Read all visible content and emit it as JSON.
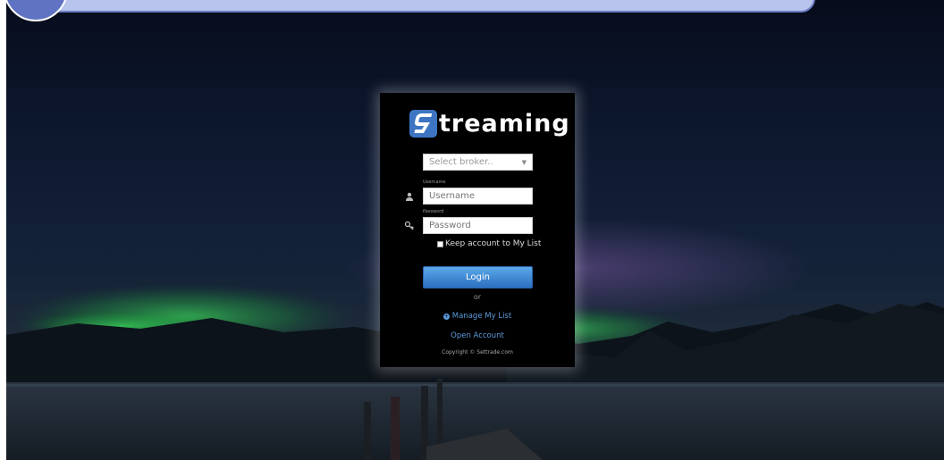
{
  "app": {
    "brand_text": "treaming",
    "brand_mark_letter": "S"
  },
  "form": {
    "broker_placeholder": "Select broker..",
    "username_label": "Username",
    "username_placeholder": "Username",
    "password_label": "Password",
    "password_placeholder": "Password",
    "keep_account_label": "Keep account to My List",
    "keep_account_checked": false,
    "login_label": "Login",
    "or_text": "or",
    "manage_list_label": "Manage My List",
    "open_account_label": "Open Account",
    "copyright": "Copyright © Settrade.com"
  },
  "icons": {
    "username": "user-icon",
    "password": "key-icon",
    "manage": "plus-circle-icon",
    "broker_dropdown": "chevron-down-icon"
  },
  "colors": {
    "panel_bg": "#000000",
    "login_button": "#3a82d0",
    "link": "#5d9bdc",
    "top_banner": "#b9c4ec",
    "top_circle": "#5f73c2"
  }
}
